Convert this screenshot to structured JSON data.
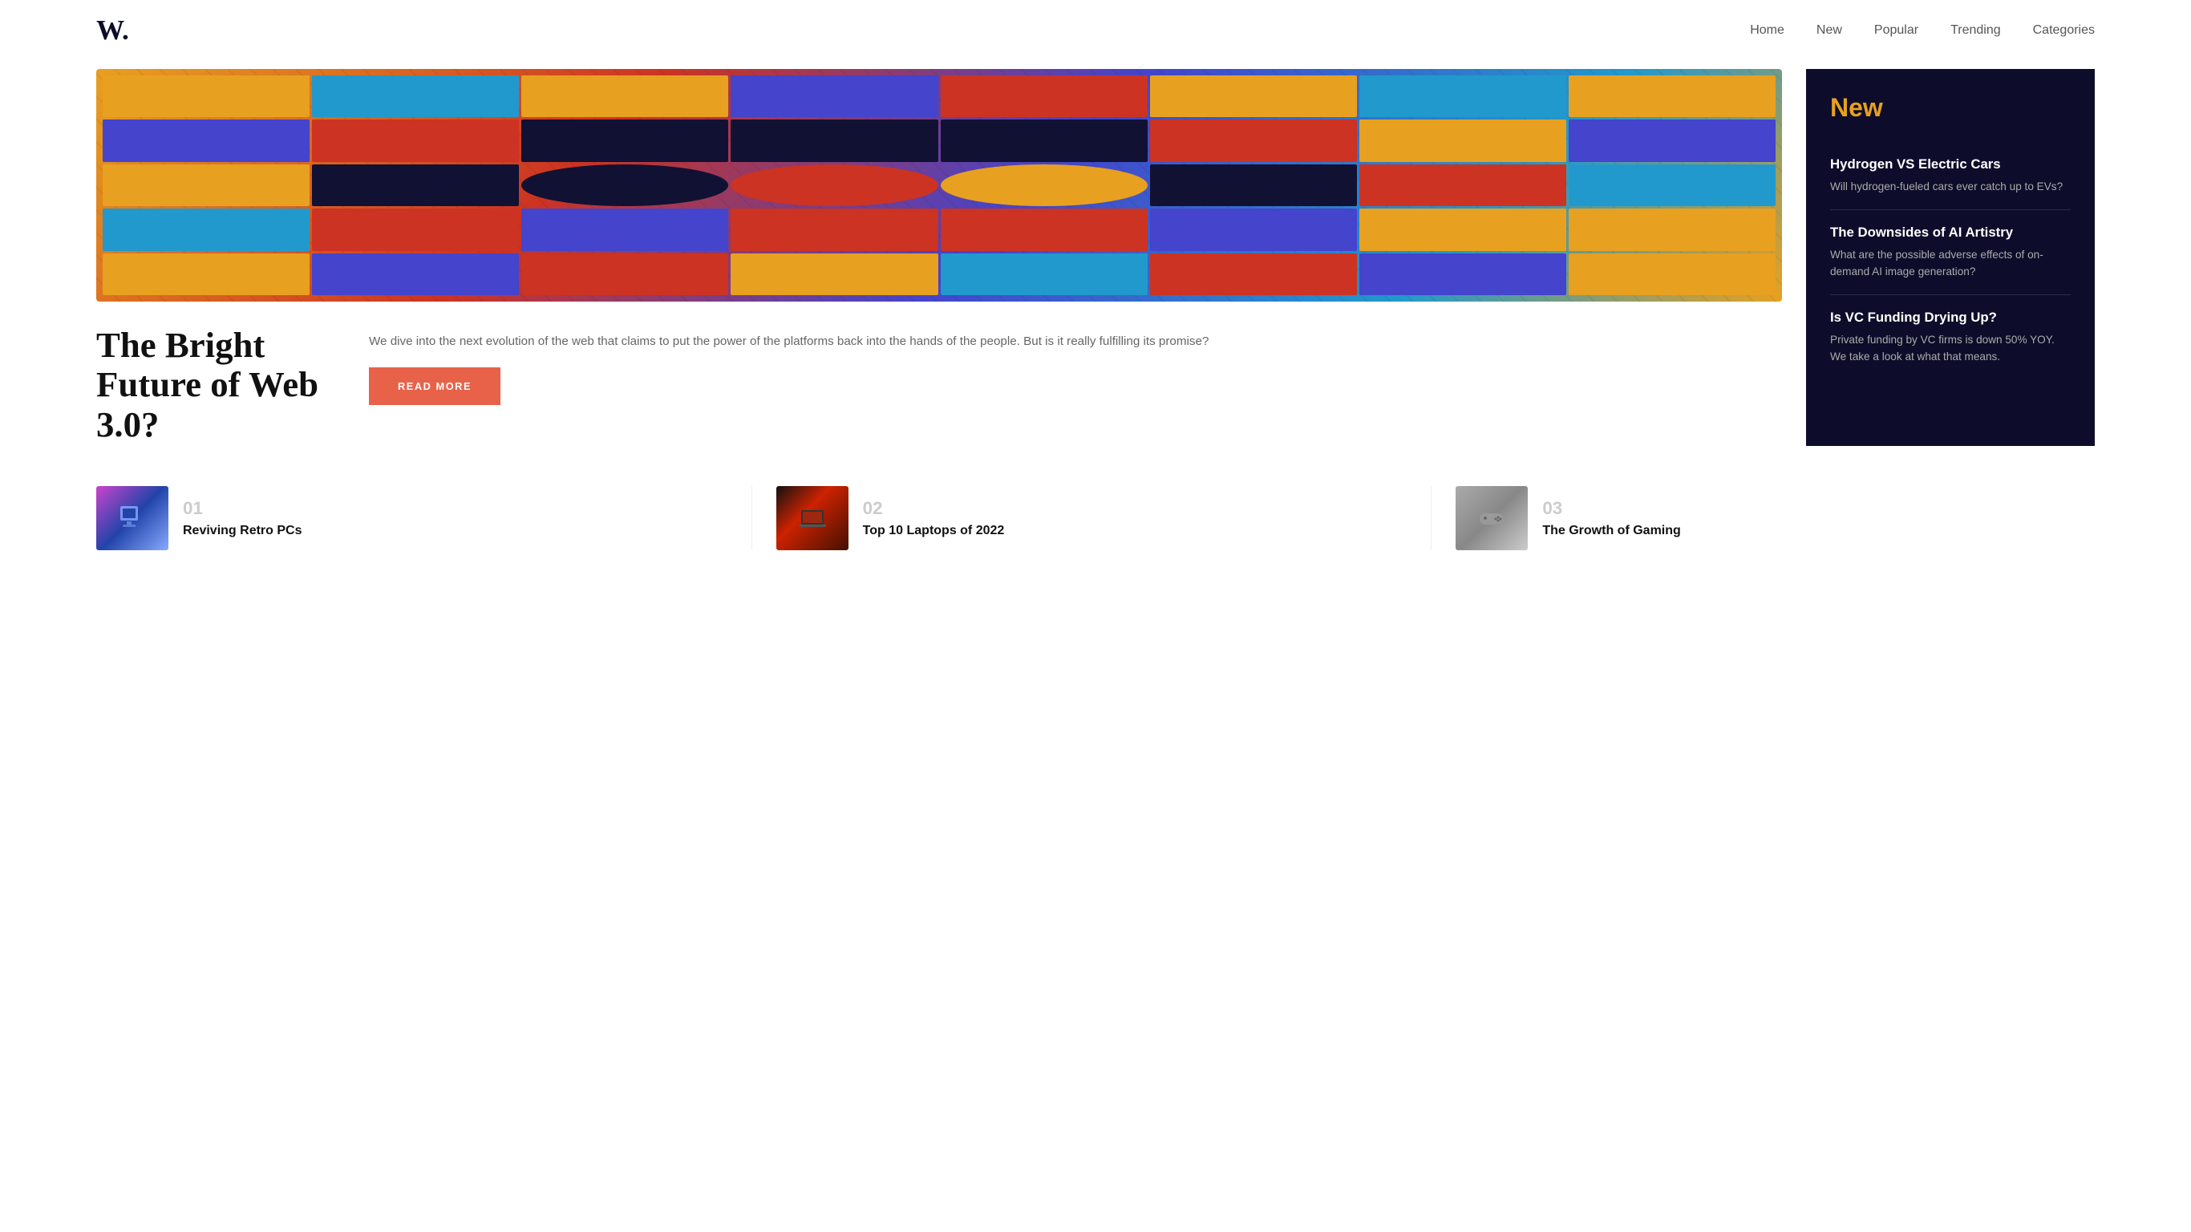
{
  "logo": "W.",
  "nav": {
    "links": [
      {
        "label": "Home",
        "id": "home"
      },
      {
        "label": "New",
        "id": "new"
      },
      {
        "label": "Popular",
        "id": "popular"
      },
      {
        "label": "Trending",
        "id": "trending"
      },
      {
        "label": "Categories",
        "id": "categories"
      }
    ]
  },
  "hero": {
    "title": "The Bright Future of Web 3.0?",
    "description": "We dive into the next evolution of the web that claims to put the power of the platforms back into the hands of the people. But is it really fulfilling its promise?",
    "read_more_label": "READ MORE"
  },
  "sidebar": {
    "section_title": "New",
    "articles": [
      {
        "title": "Hydrogen VS Electric Cars",
        "description": "Will hydrogen-fueled cars ever catch up to EVs?"
      },
      {
        "title": "The Downsides of AI Artistry",
        "description": "What are the possible adverse effects of on-demand AI image generation?"
      },
      {
        "title": "Is VC Funding Drying Up?",
        "description": "Private funding by VC firms is down 50% YOY. We take a look at what that means."
      }
    ]
  },
  "bottom_articles": [
    {
      "number": "01",
      "title": "Reviving Retro PCs",
      "thumb_type": "retro"
    },
    {
      "number": "02",
      "title": "Top 10 Laptops of 2022",
      "thumb_type": "laptop"
    },
    {
      "number": "03",
      "title": "The Growth of Gaming",
      "thumb_type": "gaming"
    }
  ]
}
